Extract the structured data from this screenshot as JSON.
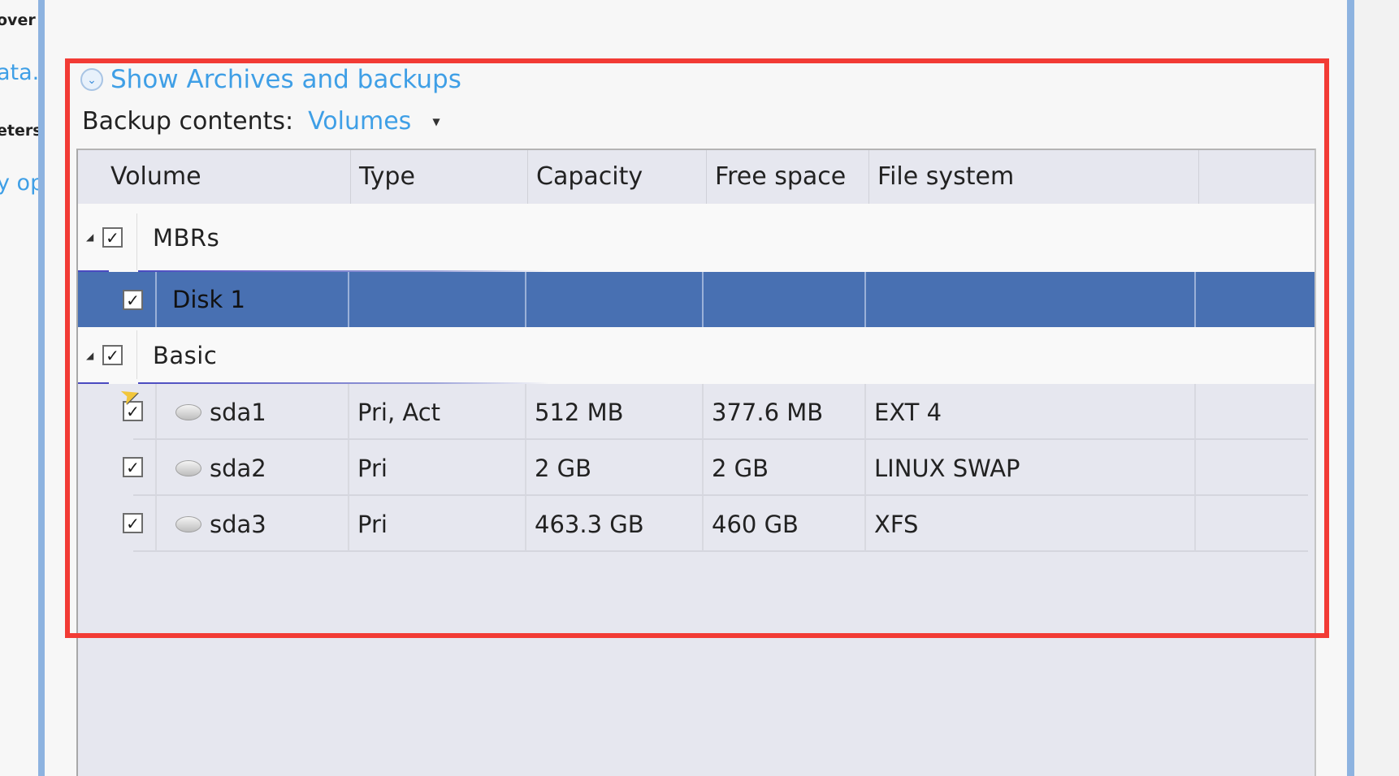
{
  "left_panel": {
    "fragments": [
      "over",
      "ata.",
      "eters",
      "y op"
    ]
  },
  "show_archives": {
    "label": "Show Archives and backups"
  },
  "backup_contents": {
    "label": "Backup contents:",
    "value": "Volumes"
  },
  "columns": [
    "Volume",
    "Type",
    "Capacity",
    "Free space",
    "File system"
  ],
  "groups": [
    {
      "name": "MBRs",
      "checked": true,
      "expanded": true
    },
    {
      "name": "Basic",
      "checked": true,
      "expanded": true
    }
  ],
  "mbr_rows": [
    {
      "volume": "Disk 1",
      "checked": true,
      "selected": true
    }
  ],
  "basic_rows": [
    {
      "volume": "sda1",
      "type": "Pri, Act",
      "capacity": "512 MB",
      "free": "377.6 MB",
      "fs": "EXT 4",
      "checked": true
    },
    {
      "volume": "sda2",
      "type": "Pri",
      "capacity": "2 GB",
      "free": "2 GB",
      "fs": "LINUX SWAP",
      "checked": true
    },
    {
      "volume": "sda3",
      "type": "Pri",
      "capacity": "463.3 GB",
      "free": "460 GB",
      "fs": "XFS",
      "checked": true
    }
  ],
  "colors": {
    "selection": "#4870b2",
    "link": "#3f9fe6",
    "highlight": "#f23b35"
  }
}
